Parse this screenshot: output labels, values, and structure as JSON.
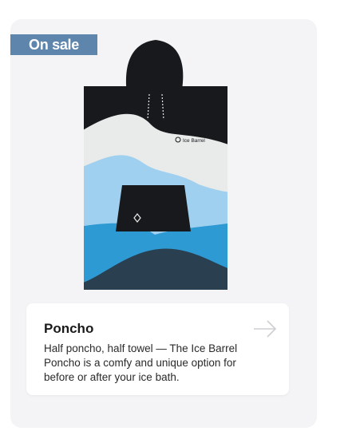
{
  "card": {
    "badge_label": "On sale",
    "product_name": "Poncho",
    "description": "Half poncho, half towel — The Ice Barrel Poncho is a comfy and unique option for before or after your ice bath.",
    "brand_logo_text": "Ice Barrel",
    "arrow_icon": "arrow-right-icon"
  },
  "colors": {
    "badge": "#5e86ad",
    "card_bg": "#f4f4f6",
    "poncho_black": "#17191c",
    "poncho_white": "#e9ebea",
    "poncho_light_blue": "#9fd0ef",
    "poncho_blue": "#2d9ad3",
    "poncho_navy": "#2a3f50"
  }
}
